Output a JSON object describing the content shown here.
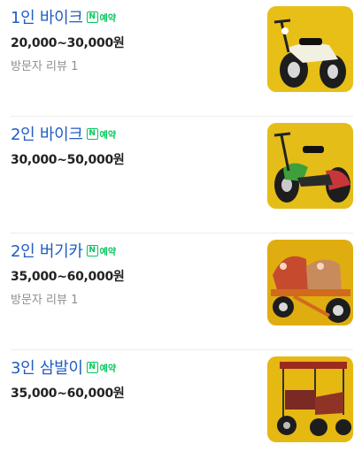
{
  "badge": {
    "n": "N",
    "label": "예약"
  },
  "items": [
    {
      "title": "1인 바이크",
      "price": "20,000~30,000원",
      "review": "방문자 리뷰 1",
      "image": "scooter-yellow-black",
      "bg": "#e7bf17"
    },
    {
      "title": "2인 바이크",
      "price": "30,000~50,000원",
      "review": "",
      "image": "scooter-green-red",
      "bg": "#e4bd18"
    },
    {
      "title": "2인 버기카",
      "price": "35,000~60,000원",
      "review": "방문자 리뷰 1",
      "image": "buggy-orange",
      "bg": "#e0ad10"
    },
    {
      "title": "3인 삼발이",
      "price": "35,000~60,000원",
      "review": "",
      "image": "tricycle-red",
      "bg": "#e6b812"
    }
  ]
}
